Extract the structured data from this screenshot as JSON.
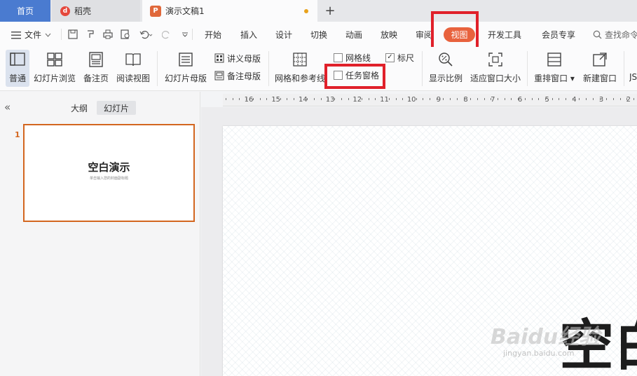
{
  "tabs": {
    "home": "首页",
    "daoke": "稻壳",
    "document": "演示文稿1",
    "new_tab": "+"
  },
  "menu": {
    "file": "文件",
    "items": [
      "开始",
      "插入",
      "设计",
      "切换",
      "动画",
      "放映",
      "审阅",
      "视图",
      "开发工具",
      "会员专享"
    ],
    "search": "查找命令"
  },
  "ribbon": {
    "normal": "普通",
    "slide_sorter": "幻灯片浏览",
    "notes_page": "备注页",
    "reading_view": "阅读视图",
    "slide_master": "幻灯片母版",
    "handout_master": "讲义母版",
    "notes_master": "备注母版",
    "grid_guides": "网格和参考线",
    "gridlines": "网格线",
    "task_pane": "任务窗格",
    "ruler": "标尺",
    "zoom": "显示比例",
    "fit_window": "适应窗口大小",
    "arrange_windows": "重排窗口",
    "new_window": "新建窗口",
    "overflow": "JS"
  },
  "panel": {
    "collapse": "«",
    "outline_tab": "大纲",
    "slides_tab": "幻灯片",
    "slide_number": "1",
    "thumb_title": "空白演示",
    "thumb_subtitle": "单击输入您的封面副标题"
  },
  "ruler": {
    "numbers": [
      "16",
      "15",
      "14",
      "13",
      "12",
      "11",
      "10",
      "9",
      "8",
      "7",
      "6",
      "5",
      "4",
      "3",
      "2"
    ]
  },
  "slide": {
    "title_fragment": "空白"
  },
  "watermark": {
    "text": "Baidu经验",
    "url": "jingyan.baidu.com"
  },
  "colors": {
    "accent": "#e8623d",
    "highlight_box": "#e0202a",
    "home_tab": "#4a7bd0",
    "selected_slide_border": "#d3661f"
  }
}
